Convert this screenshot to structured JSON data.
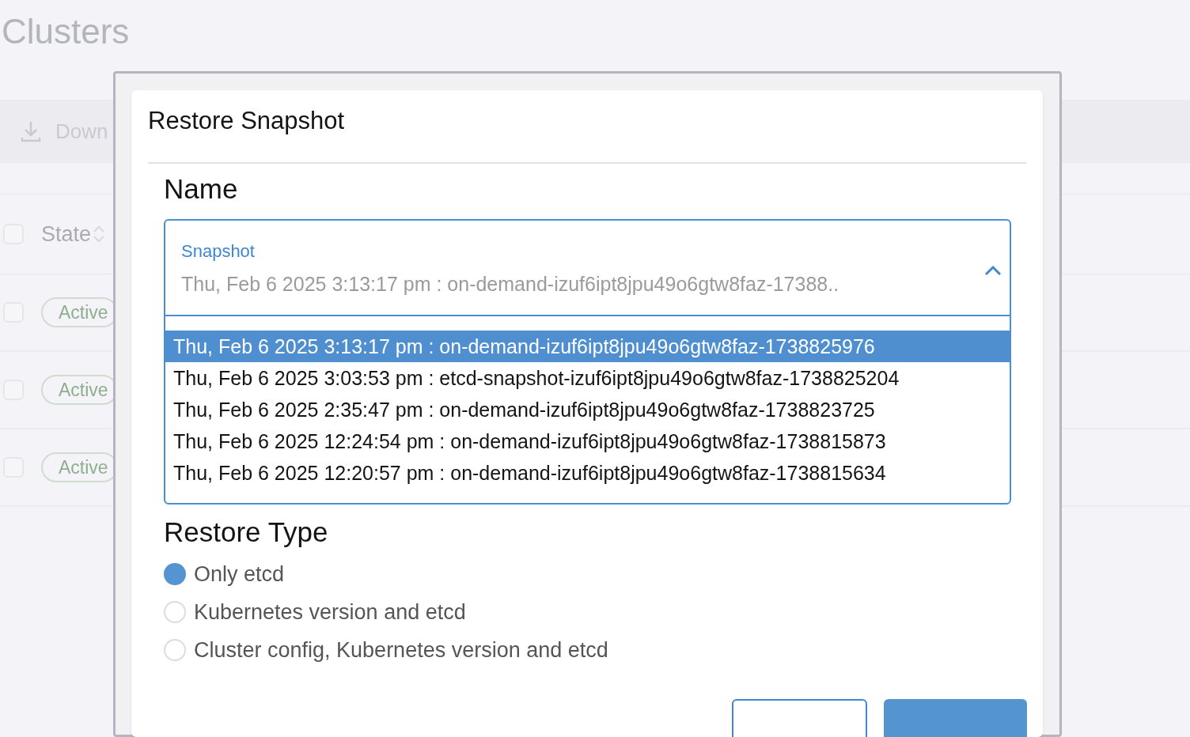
{
  "page": {
    "title": "Clusters"
  },
  "toolbar": {
    "download_button": "Down"
  },
  "table": {
    "columns": [
      "State"
    ],
    "select_all_checked": false,
    "rows": [
      {
        "checked": false,
        "state": "Active"
      },
      {
        "checked": false,
        "state": "Active"
      },
      {
        "checked": false,
        "state": "Active"
      }
    ]
  },
  "dialog": {
    "title": "Restore Snapshot",
    "name_heading": "Name",
    "snapshot_select": {
      "label": "Snapshot",
      "value": "Thu, Feb 6 2025 3:13:17 pm : on-demand-izuf6ipt8jpu49o6gtw8faz-17388..",
      "expanded": true,
      "options": [
        {
          "label": "Thu, Feb 6 2025 3:13:17 pm : on-demand-izuf6ipt8jpu49o6gtw8faz-1738825976",
          "selected": true
        },
        {
          "label": "Thu, Feb 6 2025 3:03:53 pm : etcd-snapshot-izuf6ipt8jpu49o6gtw8faz-1738825204",
          "selected": false
        },
        {
          "label": "Thu, Feb 6 2025 2:35:47 pm : on-demand-izuf6ipt8jpu49o6gtw8faz-1738823725",
          "selected": false
        },
        {
          "label": "Thu, Feb 6 2025 12:24:54 pm : on-demand-izuf6ipt8jpu49o6gtw8faz-1738815873",
          "selected": false
        },
        {
          "label": "Thu, Feb 6 2025 12:20:57 pm : on-demand-izuf6ipt8jpu49o6gtw8faz-1738815634",
          "selected": false
        }
      ]
    },
    "restore_type": {
      "heading": "Restore Type",
      "options": [
        {
          "label": "Only etcd",
          "selected": true
        },
        {
          "label": "Kubernetes version and etcd",
          "selected": false
        },
        {
          "label": "Cluster config, Kubernetes version and etcd",
          "selected": false
        }
      ]
    }
  }
}
